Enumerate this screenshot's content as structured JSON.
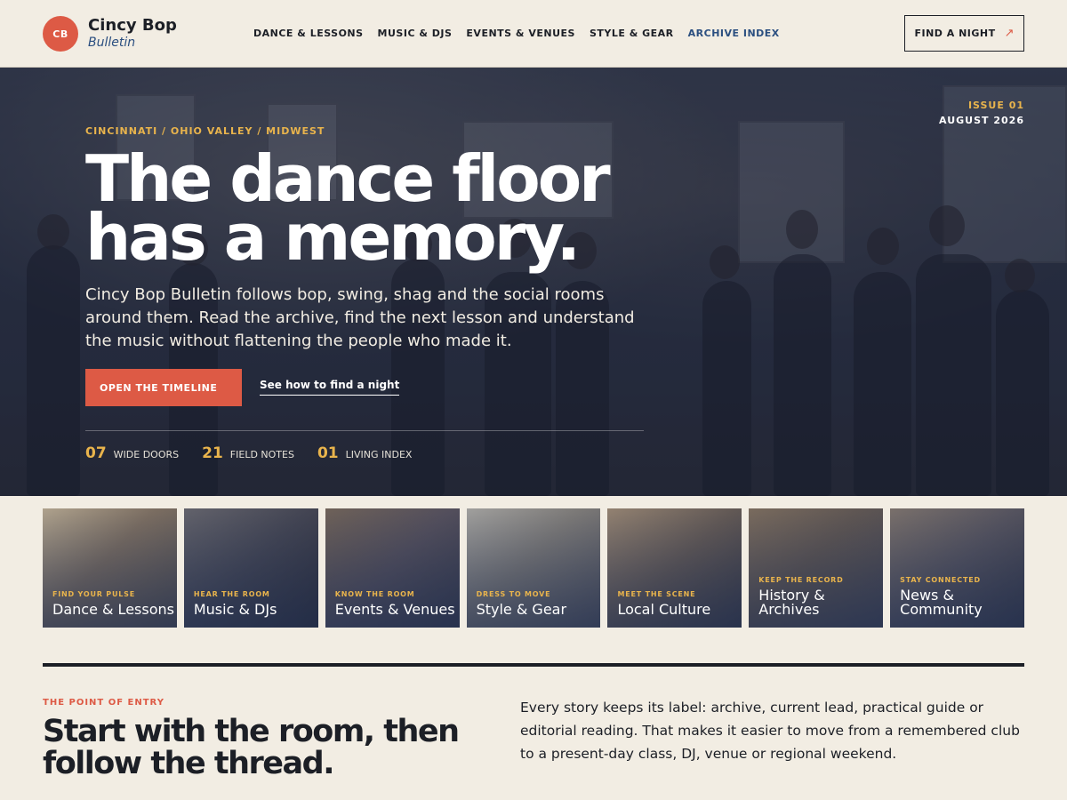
{
  "brand": {
    "badge": "CB",
    "name": "Cincy Bop",
    "subtitle": "Bulletin"
  },
  "nav": {
    "items": [
      {
        "label": "DANCE & LESSONS",
        "active": false
      },
      {
        "label": "MUSIC & DJS",
        "active": false
      },
      {
        "label": "EVENTS & VENUES",
        "active": false
      },
      {
        "label": "STYLE & GEAR",
        "active": false
      },
      {
        "label": "ARCHIVE INDEX",
        "active": true
      }
    ],
    "cta_label": "FIND A NIGHT",
    "cta_icon": "arrow-up-right-icon"
  },
  "hero": {
    "kicker": "CINCINNATI / OHIO VALLEY / MIDWEST",
    "issue": "ISSUE 01",
    "date": "AUGUST 2026",
    "title": "The dance floor has a memory.",
    "description": "Cincy Bop Bulletin follows bop, swing, shag and the social rooms around them. Read the archive, find the next lesson and understand the music without flattening the people who made it.",
    "primary_cta": "OPEN THE TIMELINE",
    "secondary_cta": "See how to find a night",
    "stats": [
      {
        "num": "07",
        "label": "WIDE DOORS"
      },
      {
        "num": "21",
        "label": "FIELD NOTES"
      },
      {
        "num": "01",
        "label": "LIVING INDEX"
      }
    ]
  },
  "cards": [
    {
      "kicker": "FIND YOUR PULSE",
      "title": "Dance & Lessons"
    },
    {
      "kicker": "HEAR THE ROOM",
      "title": "Music & DJs"
    },
    {
      "kicker": "KNOW THE ROOM",
      "title": "Events & Venues"
    },
    {
      "kicker": "DRESS TO MOVE",
      "title": "Style & Gear"
    },
    {
      "kicker": "MEET THE SCENE",
      "title": "Local Culture"
    },
    {
      "kicker": "KEEP THE RECORD",
      "title": "History & Archives"
    },
    {
      "kicker": "STAY CONNECTED",
      "title": "News & Community"
    }
  ],
  "section": {
    "kicker": "THE POINT OF ENTRY",
    "title": "Start with the room, then follow the thread.",
    "body": "Every story keeps its label: archive, current lead, practical guide or editorial reading. That makes it easier to move from a remembered club to a present-day class, DJ, venue or regional weekend."
  },
  "colors": {
    "accent": "#dd5a45",
    "gold": "#e9b44c",
    "navy": "#2b4f80",
    "paper": "#f2ede3",
    "ink": "#1c1f26"
  }
}
